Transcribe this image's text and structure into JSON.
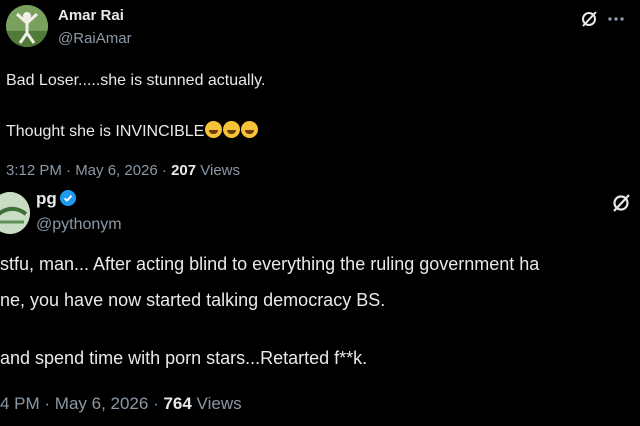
{
  "posts": [
    {
      "author": {
        "name": "Amar Rai",
        "handle": "@RaiAmar"
      },
      "lines": [
        "Bad Loser.....she is stunned actually.",
        "Thought she is INVINCIBLE"
      ],
      "emojis": [
        "rolling-on-floor-laughing-emoji",
        "loudly-crying-emoji",
        "grinning-squinting-emoji"
      ],
      "time": "3:12 PM · May 6, 2026 · ",
      "views_count": "207",
      "views_label": " Views",
      "icons": [
        "grok-icon",
        "more-icon"
      ]
    },
    {
      "author": {
        "name": "pg",
        "handle": "@pythonym",
        "verified": true
      },
      "lines": [
        "stfu, man... After acting blind to everything the ruling government ha",
        "ne, you have now started talking democracy BS.",
        " and spend time with porn stars...Retarted f**k."
      ],
      "time": "4 PM · May 6, 2026 · ",
      "views_count": "764",
      "views_label": " Views",
      "icons": [
        "grok-icon"
      ]
    }
  ],
  "colors": {
    "background": "#000000",
    "text": "#e7e9ea",
    "secondary": "#8b98a5",
    "verified": "#1d9bf0"
  }
}
